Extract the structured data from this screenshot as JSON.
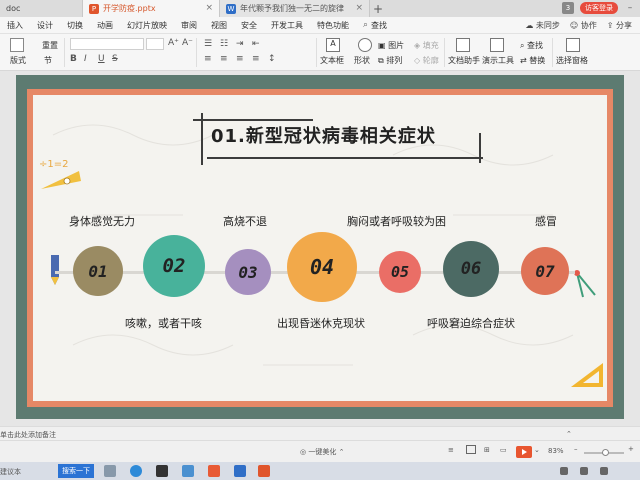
{
  "tabs": {
    "doc_tab": "doc",
    "active_tab": "开学防疫.pptx",
    "other_tab": "年代颗予我们独一无二的旋律",
    "plus": "+"
  },
  "window": {
    "page_badge": "3",
    "login": "访客登录"
  },
  "menu": {
    "items": [
      "插入",
      "设计",
      "切换",
      "动画",
      "幻灯片放映",
      "审阅",
      "视图",
      "安全",
      "开发工具",
      "特色功能"
    ],
    "search": "查找",
    "right_items": [
      "未同步",
      "协作",
      "分享"
    ]
  },
  "toolbar": {
    "layout_label": "版式",
    "section_label": "节",
    "reset_label": "重置",
    "bold": "B",
    "italic": "I",
    "underline": "U",
    "strike": "S",
    "fontsize_up": "A⁺",
    "fontsize_down": "A⁻",
    "textbox_label": "文本框",
    "shape_label": "形状",
    "image_label": "图片",
    "arrange_label": "排列",
    "fill_label": "填充",
    "outline_label": "轮廓",
    "doc_helper_label": "文档助手",
    "present_tools_label": "演示工具",
    "find_label": "查找",
    "replace_label": "替换",
    "select_pane_label": "选择窗格"
  },
  "slide": {
    "title": "01.新型冠状病毒相关症状",
    "items": [
      {
        "num": "01",
        "label": "身体感觉无力",
        "color": "#9a8b63"
      },
      {
        "num": "02",
        "label": "咳嗽，或者干咳",
        "color": "#48b29b"
      },
      {
        "num": "03",
        "label": "高烧不退",
        "color": "#a58fbf"
      },
      {
        "num": "04",
        "label": "出现昏迷休克现状",
        "color": "#f2a94a"
      },
      {
        "num": "05",
        "label": "胸闷或者呼吸较为困",
        "color": "#ea6e66"
      },
      {
        "num": "06",
        "label": "呼吸窘迫综合症状",
        "color": "#4c6a64"
      },
      {
        "num": "07",
        "label": "感冒",
        "color": "#df7357"
      }
    ],
    "deco_text": "÷1=2"
  },
  "status": {
    "notes_hint": "单击此处添加备注",
    "beautify": "一键美化",
    "zoom": "83%"
  },
  "taskbar": {
    "search_label": "搜索一下",
    "left_label": "建议本"
  }
}
